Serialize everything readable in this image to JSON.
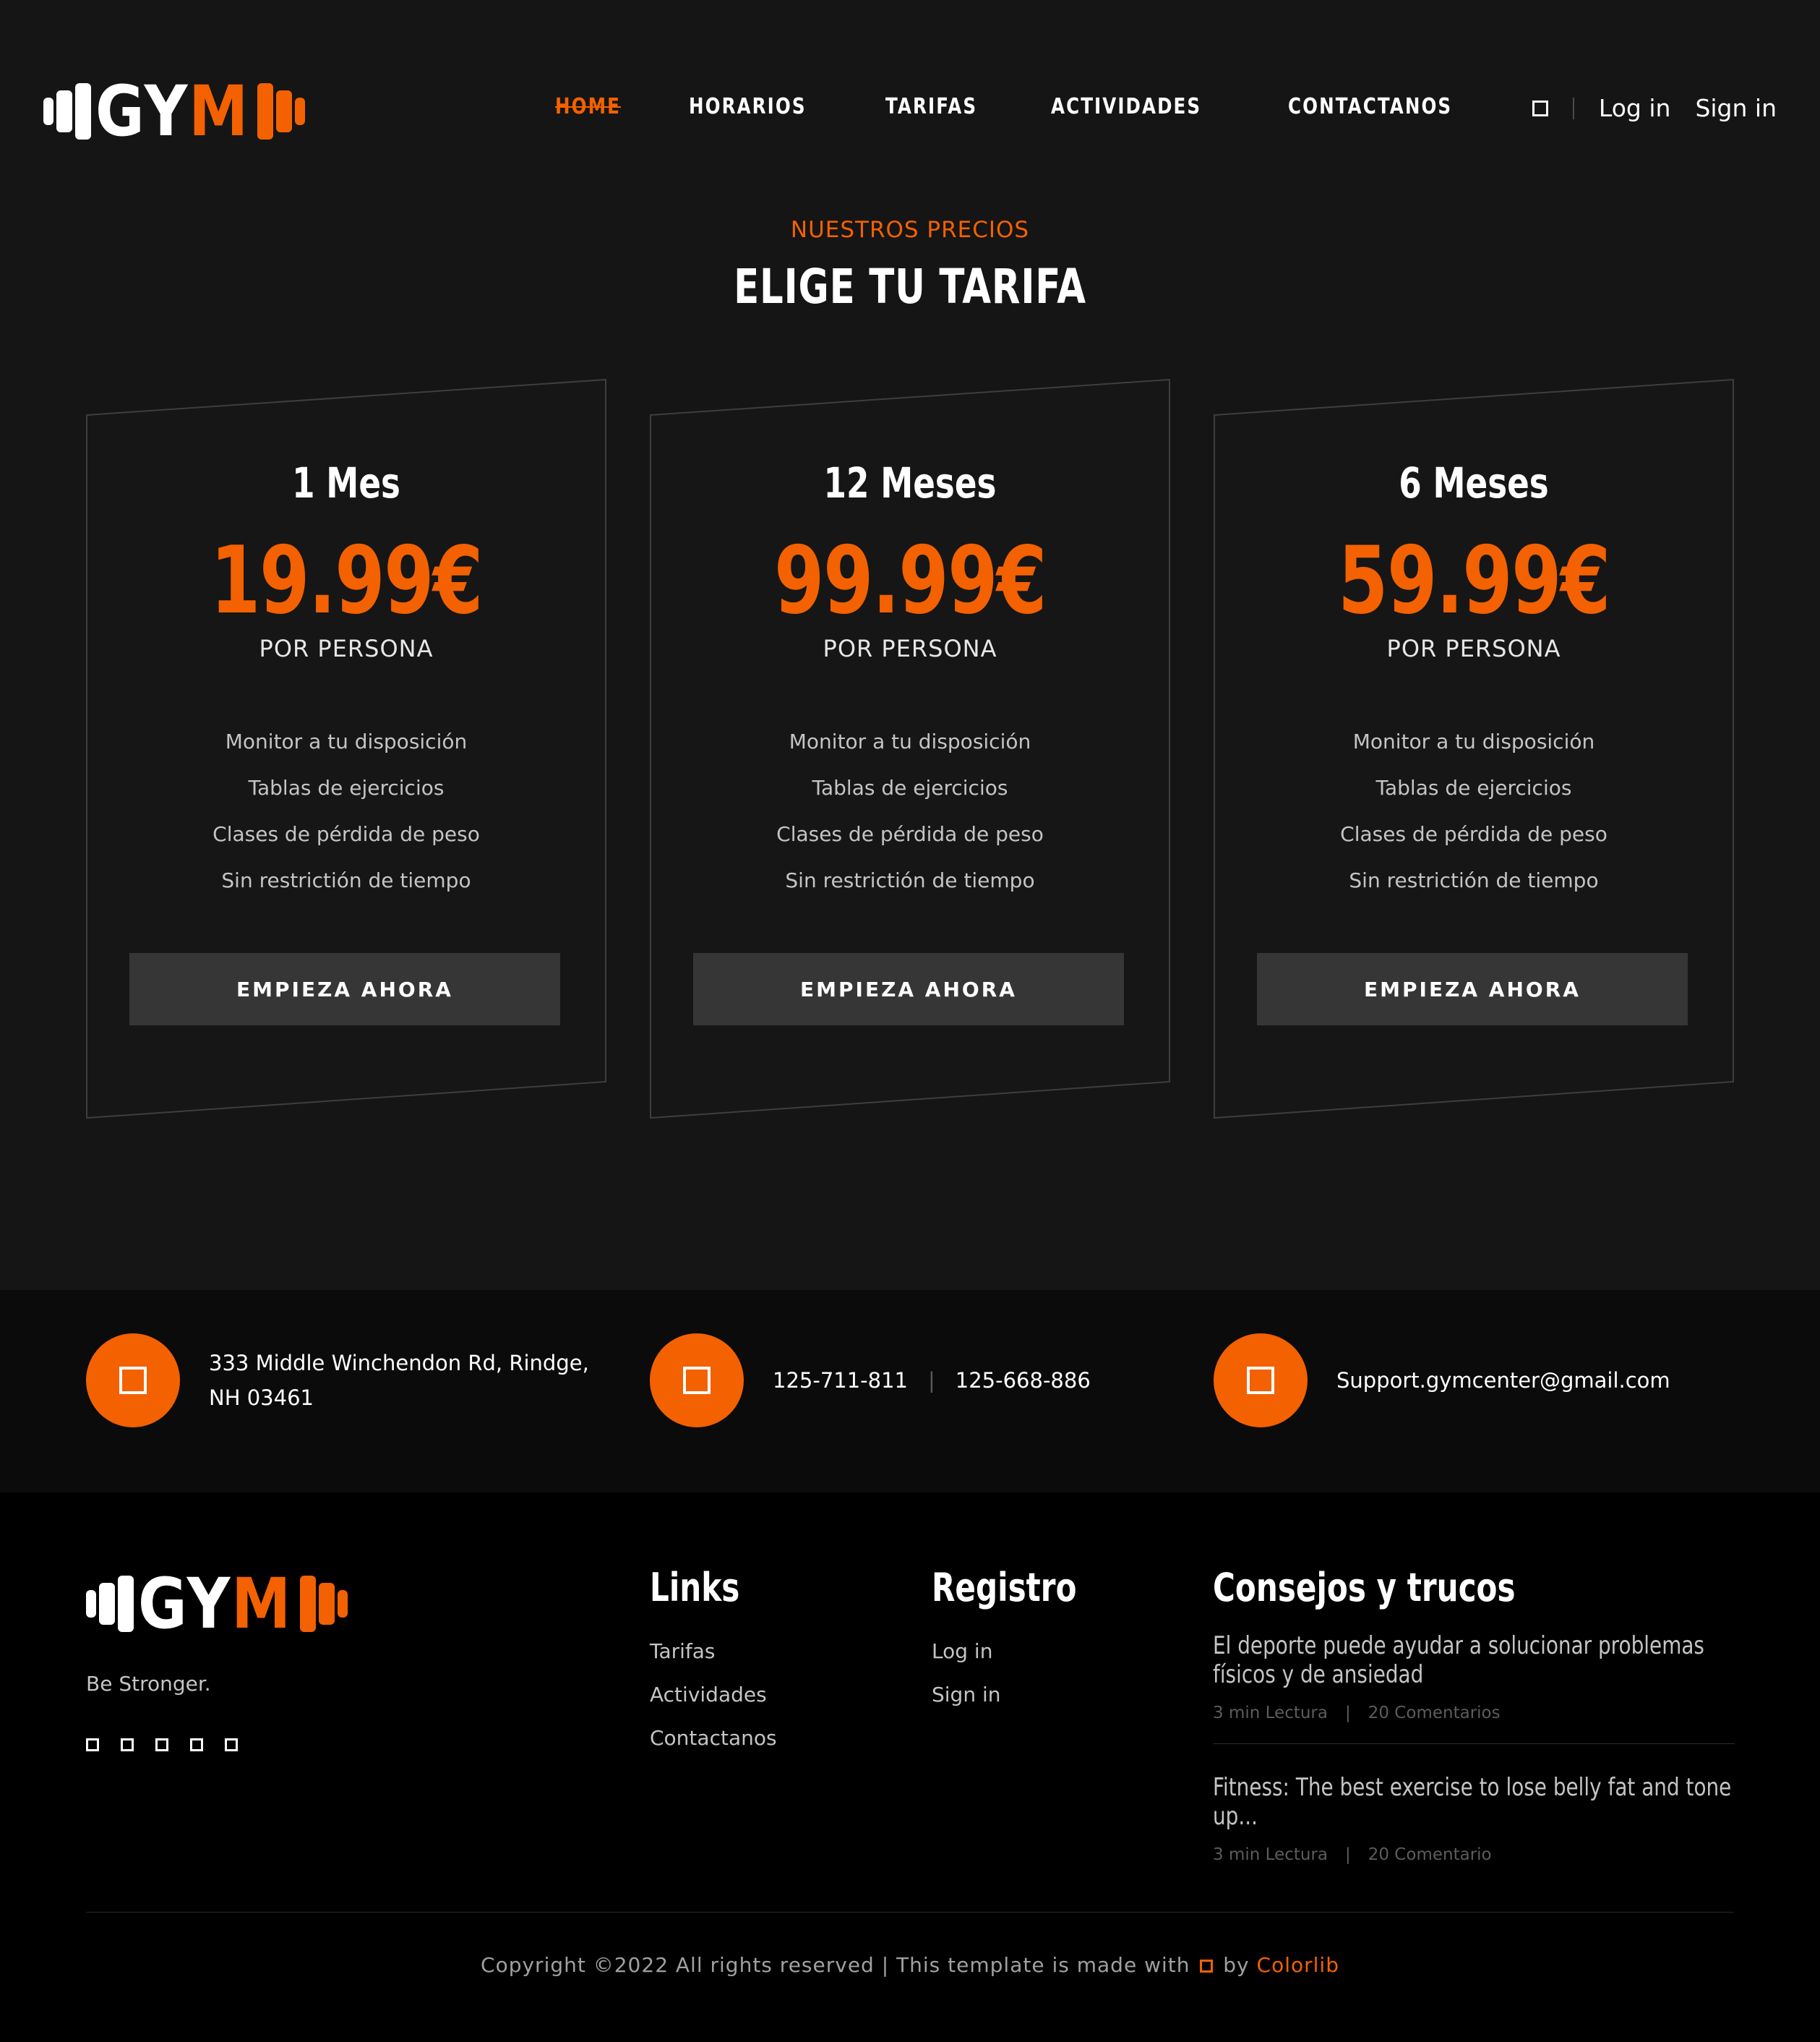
{
  "header": {
    "logo": {
      "left": "GY",
      "right": "M"
    },
    "nav": [
      "HOME",
      "HORARIOS",
      "TARIFAS",
      "ACTIVIDADES",
      "CONTACTANOS"
    ],
    "login": "Log in",
    "signin": "Sign in"
  },
  "pricing": {
    "subtitle": "NUESTROS PRECIOS",
    "title": "ELIGE TU TARIFA",
    "plans": [
      {
        "name": "1 Mes",
        "price": "19.99€",
        "per": "POR PERSONA",
        "features": [
          "Monitor a tu disposición",
          "Tablas de ejercicios",
          "Clases de pérdida de peso",
          "Sin restrictión de tiempo"
        ],
        "button": "EMPIEZA AHORA"
      },
      {
        "name": "12 Meses",
        "price": "99.99€",
        "per": "POR PERSONA",
        "features": [
          "Monitor a tu disposición",
          "Tablas de ejercicios",
          "Clases de pérdida de peso",
          "Sin restrictión de tiempo"
        ],
        "button": "EMPIEZA AHORA"
      },
      {
        "name": "6 Meses",
        "price": "59.99€",
        "per": "POR PERSONA",
        "features": [
          "Monitor a tu disposición",
          "Tablas de ejercicios",
          "Clases de pérdida de peso",
          "Sin restrictión de tiempo"
        ],
        "button": "EMPIEZA AHORA"
      }
    ]
  },
  "contact": {
    "address_line1": "333 Middle Winchendon Rd, Rindge,",
    "address_line2": "NH 03461",
    "phone1": "125-711-811",
    "phone_sep": "|",
    "phone2": "125-668-886",
    "email": "Support.gymcenter@gmail.com"
  },
  "footer": {
    "logo": {
      "left": "GY",
      "right": "M"
    },
    "tagline": "Be Stronger.",
    "links_title": "Links",
    "links": [
      "Tarifas",
      "Actividades",
      "Contactanos"
    ],
    "registro_title": "Registro",
    "registro": [
      "Log in",
      "Sign in"
    ],
    "tips_title": "Consejos y trucos",
    "tips": [
      {
        "title": "El deporte puede ayudar a solucionar problemas físicos y de ansiedad",
        "read": "3 min Lectura",
        "sep": "|",
        "comments": "20 Comentarios"
      },
      {
        "title": "Fitness: The best exercise to lose belly fat and tone up...",
        "read": "3 min Lectura",
        "sep": "|",
        "comments": "20 Comentario"
      }
    ],
    "copyright_pre": "Copyright ©2022 All rights reserved | This template is made with",
    "copyright_by": "by",
    "copyright_brand": "Colorlib"
  },
  "colors": {
    "accent": "#f36100",
    "background": "#151515",
    "contact_bg": "#0b0b0b",
    "footer_bg": "#000000"
  },
  "icons": [
    "search-icon",
    "location-icon",
    "phone-icon",
    "email-icon",
    "facebook-icon",
    "twitter-icon",
    "youtube-icon",
    "instagram-icon",
    "envelope-icon",
    "heart-icon"
  ]
}
